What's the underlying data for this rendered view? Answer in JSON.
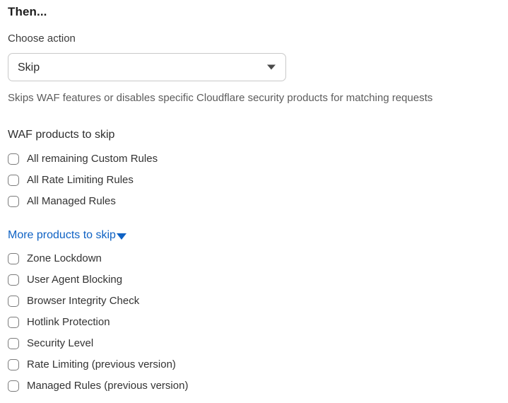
{
  "panel": {
    "section_title": "Then...",
    "action_field": {
      "label": "Choose action",
      "selected_value": "Skip",
      "caret_icon": "chevron-down-icon",
      "help_text": "Skips WAF features or disables specific Cloudflare security products for matching requests"
    },
    "waf_products_group": {
      "heading": "WAF products to skip",
      "items": [
        {
          "label": "All remaining Custom Rules",
          "checked": false
        },
        {
          "label": "All Rate Limiting Rules",
          "checked": false
        },
        {
          "label": "All Managed Rules",
          "checked": false
        }
      ]
    },
    "more_products_link": {
      "label": "More products to skip",
      "caret_icon": "caret-down-icon",
      "color": "#0f62c4"
    },
    "more_products_group": {
      "items": [
        {
          "label": "Zone Lockdown",
          "checked": false
        },
        {
          "label": "User Agent Blocking",
          "checked": false
        },
        {
          "label": "Browser Integrity Check",
          "checked": false
        },
        {
          "label": "Hotlink Protection",
          "checked": false
        },
        {
          "label": "Security Level",
          "checked": false
        },
        {
          "label": "Rate Limiting (previous version)",
          "checked": false
        },
        {
          "label": "Managed Rules (previous version)",
          "checked": false
        }
      ]
    }
  }
}
